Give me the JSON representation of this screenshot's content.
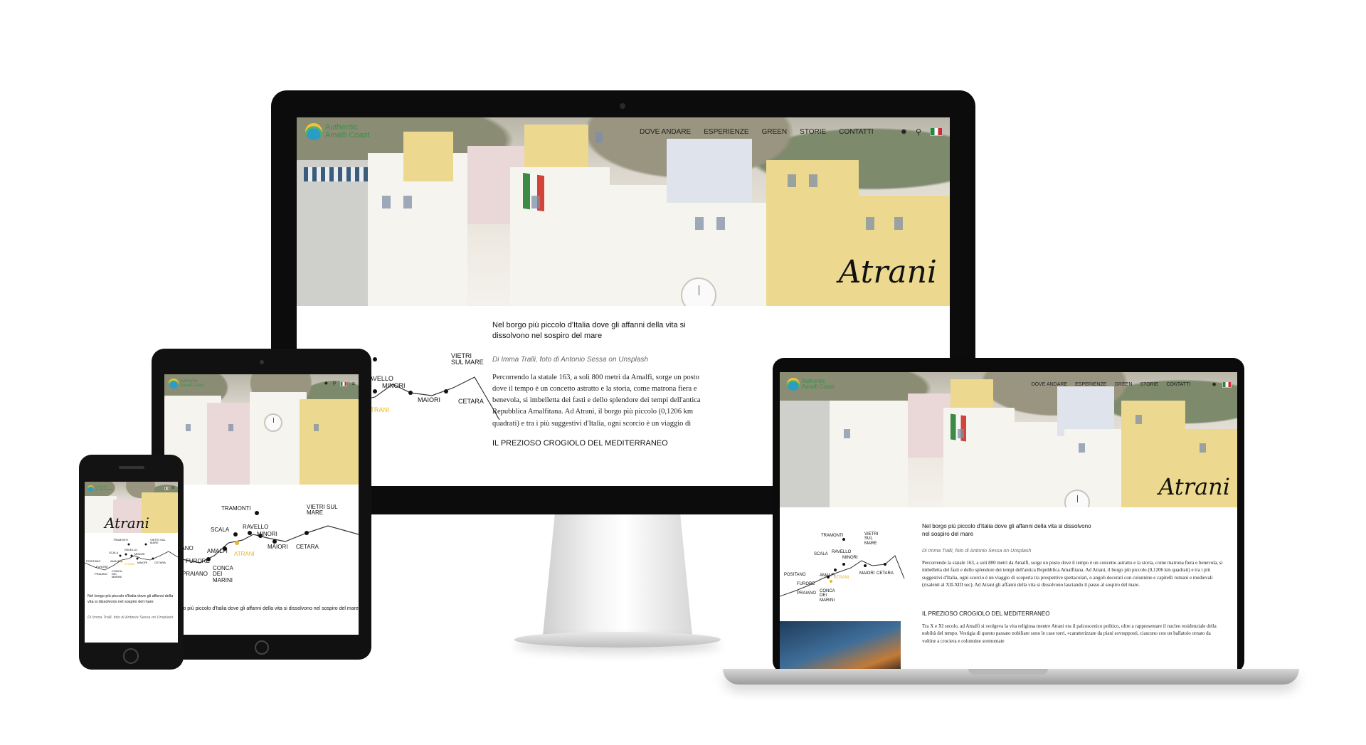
{
  "site": {
    "logo_line1": "Authentic",
    "logo_line2": "Amalfi Coast",
    "nav": [
      "DOVE ANDARE",
      "ESPERIENZE",
      "GREEN",
      "STORIE",
      "CONTATTI"
    ],
    "hero_title": "Atrani"
  },
  "article": {
    "lead": "Nel borgo più piccolo d'Italia dove gli affanni della vita si dissolvono nel sospiro del mare",
    "byline": "Di Imma Tralli, foto di Antonio Sessa on Unsplash",
    "paragraph1": "Percorrendo la statale 163, a soli 800 metri da Amalfi, sorge un posto dove il tempo è un concetto astratto e la storia, come matrona fiera e benevola, si imbelletta dei fasti e dello splendore dei tempi dell'antica Repubblica Amalfitana. Ad Atrani, il borgo più piccolo (0,1206 km quadrati) e tra i più suggestivi d'Italia, ogni scorcio è un viaggio di scoperta tra prospettive spettacolari, o angoli decorati con colonnine e capitelli romani e medievali (risalenti al XII-XIII sec). Ad Atrani gli affanni della vita si dissolvono lasciando il passo al sospiro del mare.",
    "section_title": "IL PREZIOSO CROGIOLO DEL MEDITERRANEO",
    "paragraph2": "Tra X e XI secolo, ad Amalfi si svolgeva la vita religiosa mentre Atrani era il palcoscenico politico, oltre a rappresentare il nucleo residenziale della nobiltà del tempo. Vestigia di questo passato nobiliare sono le case torri, «caratterizzate da piani sovrapposti, ciascuno con un ballatoio ornato da voltine a crociera e colonnine sormontate"
  },
  "map": {
    "places": [
      "TRAMONTI",
      "VIETRI SUL MARE",
      "SCALA",
      "RAVELLO",
      "MINORI",
      "MAIORI",
      "CETARA",
      "AMALFI",
      "ATRANI",
      "POSITANO",
      "FURORE",
      "PRAIANO",
      "CONCA DEI MARINI"
    ],
    "highlight": "ATRANI",
    "highlight_color": "#e8b91c"
  },
  "tablet_map": {
    "places": [
      "TRAMONTI",
      "VIETRI SUL MARE",
      "SCALA",
      "RAVELLO",
      "MINORI",
      "MAIORI",
      "CETARA",
      "AMALFI",
      "ATRANI",
      "POSITANO",
      "FURORE",
      "PRAIANO",
      "CONCA DEI MARINI"
    ]
  },
  "colors": {
    "logo_green": "#3b8f4a",
    "accent_yellow": "#e8b91c",
    "device_black": "#0c0c0c"
  },
  "icons": {
    "search": "search-icon",
    "settings": "gear-icon",
    "language": "italian-flag-icon"
  }
}
